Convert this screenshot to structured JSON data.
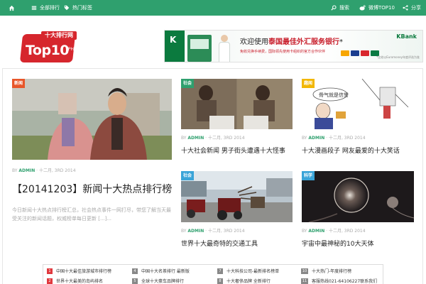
{
  "nav": {
    "home_icon": "home-icon",
    "menu1": {
      "icon": "list-icon",
      "label": "全部排行"
    },
    "menu2": {
      "icon": "tag-icon",
      "label": "热门标签"
    },
    "search": {
      "icon": "search-icon",
      "label": "搜索"
    },
    "weibo": {
      "icon": "weibo-icon",
      "label": "微博TOP10"
    },
    "share": {
      "icon": "share-icon",
      "label": "分享"
    }
  },
  "logo": {
    "cn": "十大排行网",
    "main": "Top10",
    "ph": ".PH"
  },
  "ad": {
    "title_prefix": "欢迎使用",
    "title_bold": "泰国最佳外汇服务银行",
    "title_mark": "*",
    "sub": "免收兑换手续费，国际领先使用卡组织的官方合作伙伴",
    "brand": "KBank",
    "fine": "*比较以Euromoney年度评选为准"
  },
  "posts": {
    "main": {
      "category": "新闻",
      "by": "BY",
      "author": "ADMIN",
      "date": "十二月, 3RD 2014",
      "title": "【20141203】新闻十大热点排行榜",
      "excerpt": "今日新闻十大热点排行榜汇总，社会热点事件一网打尽，带您了解当天最受关注的新闻话题，权威榜单每日更新 [...]..."
    },
    "p2": {
      "category": "社会",
      "by": "BY",
      "author": "ADMIN",
      "date": "十二月, 3RD 2014",
      "title": "十大社会新闻 男子街头遭遇十大怪事"
    },
    "p3": {
      "category": "趣闻",
      "by": "BY",
      "author": "ADMIN",
      "date": "十二月, 3RD 2014",
      "title": "十大漫画段子 网友最爱的十大笑话"
    },
    "p4": {
      "category": "社会",
      "by": "BY",
      "author": "ADMIN",
      "date": "十二月, 3RD 2014",
      "title": "世界十大最奇特的交通工具"
    },
    "p5": {
      "category": "科学",
      "by": "BY",
      "author": "ADMIN",
      "date": "十二月, 3RD 2014",
      "title": "宇宙中最神秘的10大天体"
    }
  },
  "list": [
    {
      "num": "1",
      "label": "中国十大最佳旅游城市排行榜",
      "color": "#e0393e"
    },
    {
      "num": "2",
      "label": "世界十大最美的岛屿排名",
      "color": "#e0393e"
    },
    {
      "num": "4",
      "label": "中国十大名茶排行 最新版",
      "color": "#888888"
    },
    {
      "num": "5",
      "label": "全球十大豪车品牌排行",
      "color": "#888888"
    },
    {
      "num": "7",
      "label": "十大科技公司-最新排名榜单",
      "color": "#888888"
    },
    {
      "num": "8",
      "label": "十大奢侈品牌 全新排行",
      "color": "#888888"
    },
    {
      "num": "10",
      "label": "十大热门-年度排行榜",
      "color": "#888888"
    },
    {
      "num": "11",
      "label": "客服热线021-64106227联系我们",
      "color": "#888888"
    }
  ],
  "colors": {
    "green": "#2fa06e",
    "red": "#e0393e",
    "cat_new": "#e8562a",
    "cat_blue": "#3aa4d8",
    "cat_yellow": "#f2b705"
  }
}
